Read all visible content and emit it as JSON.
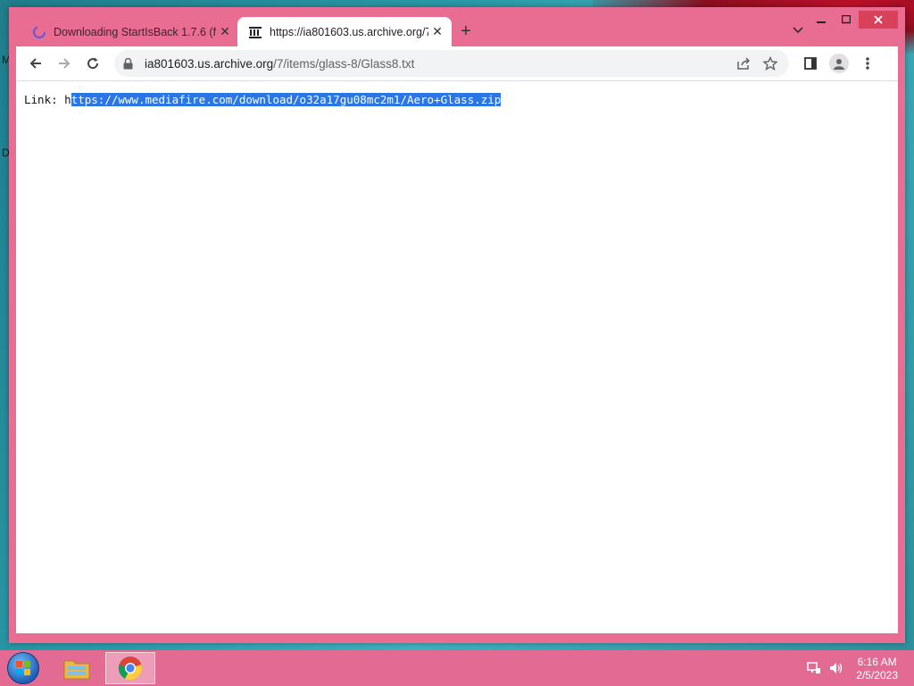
{
  "desktop": {
    "labels": [
      "M",
      "D"
    ]
  },
  "browser": {
    "tabs": [
      {
        "title": "Downloading StartIsBack 1.7.6 (f",
        "active": false,
        "favicon": "loading-spinner-icon"
      },
      {
        "title": "https://ia801603.us.archive.org/7",
        "active": true,
        "favicon": "archive-icon"
      }
    ],
    "new_tab_label": "+",
    "address": {
      "host": "ia801603.us.archive.org",
      "path": "/7/items/glass-8/Glass8.txt"
    },
    "content": {
      "prefix": "Link: h",
      "selected": "ttps://www.mediafire.com/download/o32a17gu08mc2m1/Aero+Glass.zip"
    }
  },
  "taskbar": {
    "time": "6:16 AM",
    "date": "2/5/2023"
  },
  "colors": {
    "window_frame": "#e96d93",
    "taskbar": "#e26a93",
    "selection": "#2a76e6",
    "close_button": "#d9405a"
  }
}
